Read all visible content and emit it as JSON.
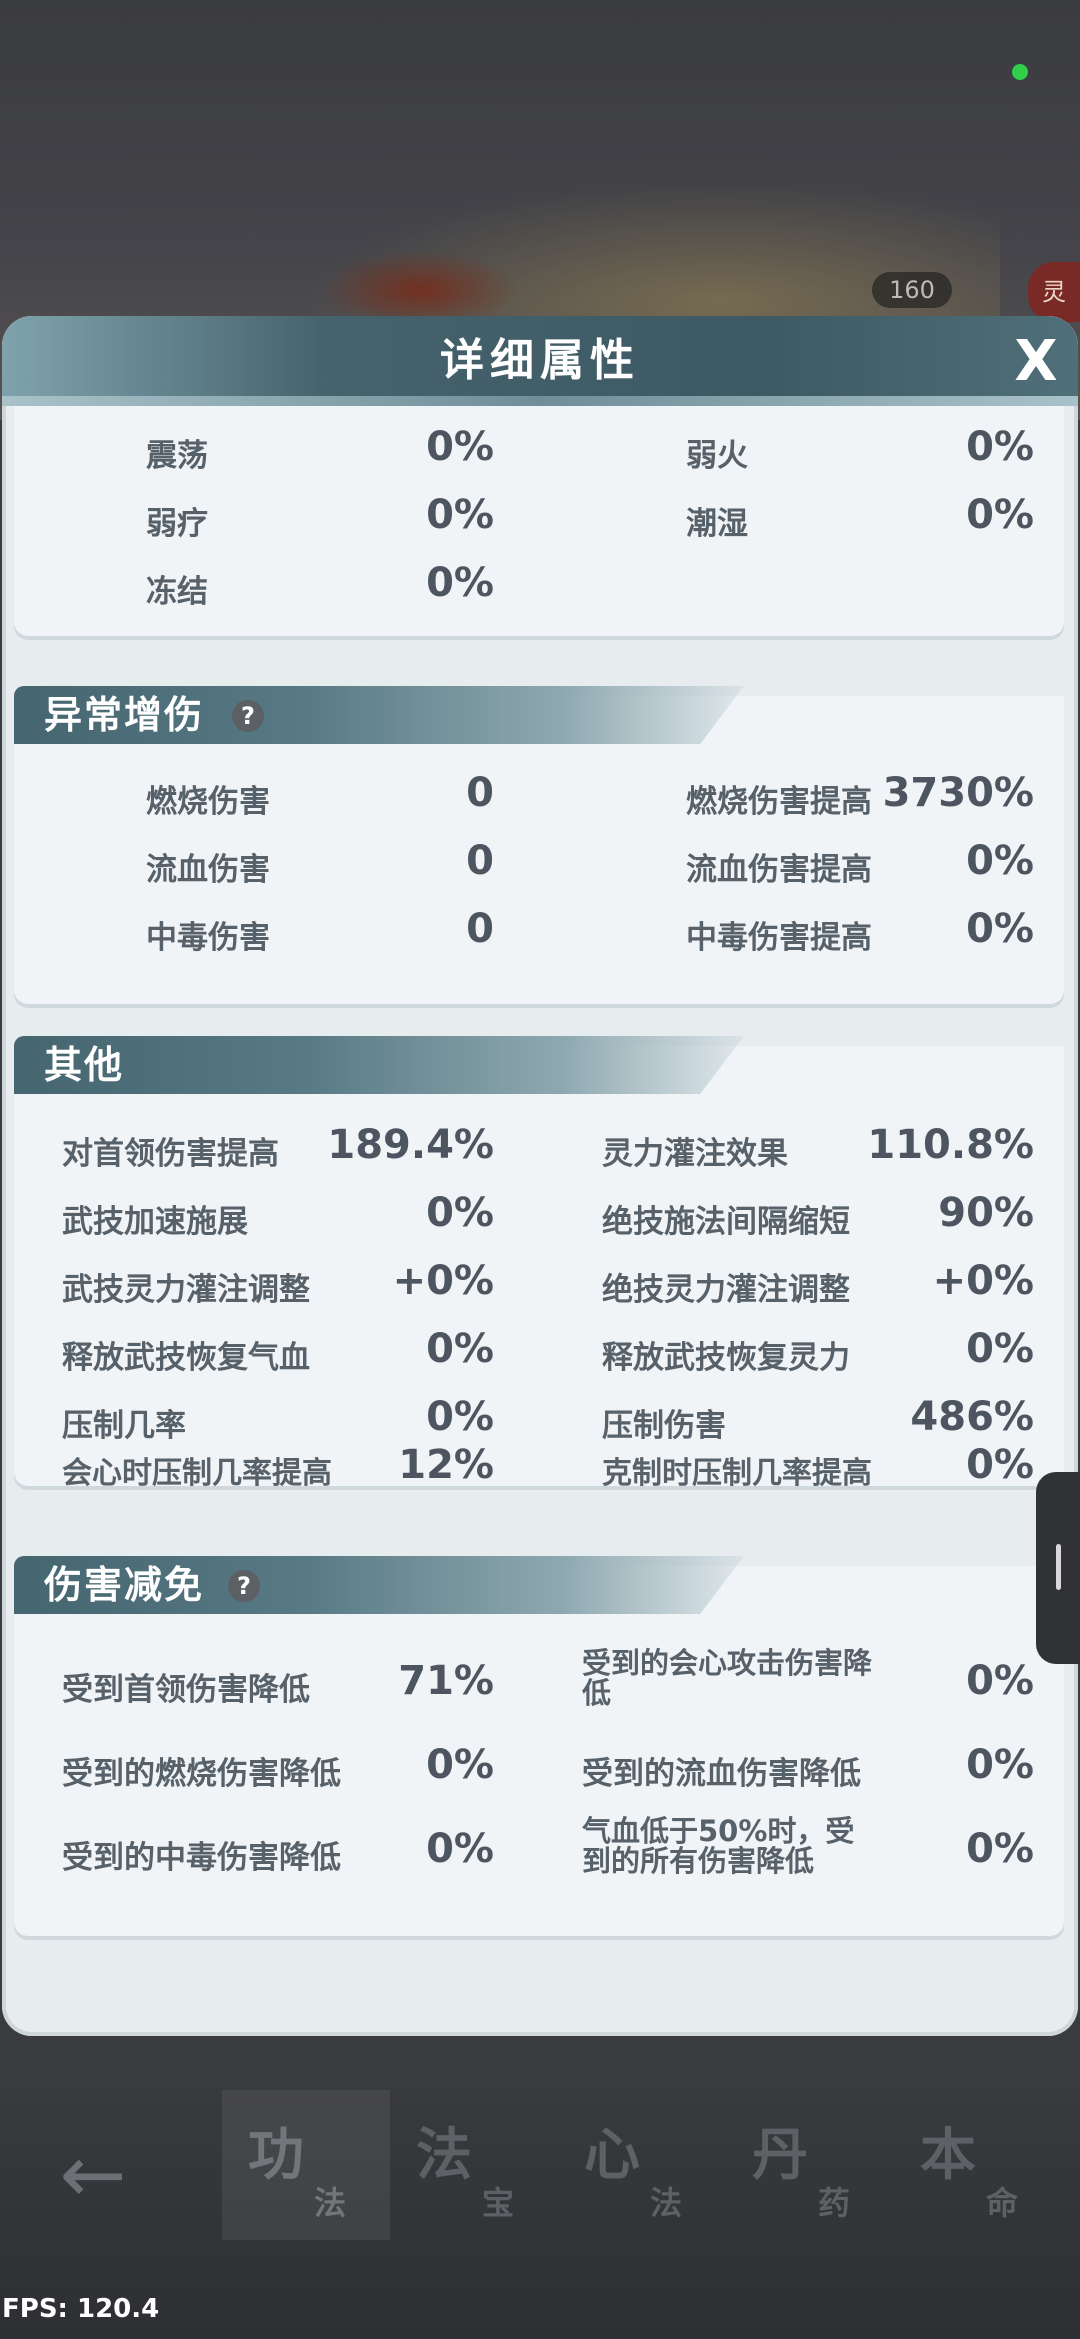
{
  "background": {
    "level_badge": "160",
    "side_badge": "灵"
  },
  "modal": {
    "title": "详细属性",
    "close_label": "X"
  },
  "control_section": {
    "rows": [
      {
        "label": "震荡",
        "value": "0%"
      },
      {
        "label": "弱火",
        "value": "0%"
      },
      {
        "label": "弱疗",
        "value": "0%"
      },
      {
        "label": "潮湿",
        "value": "0%"
      },
      {
        "label": "冻结",
        "value": "0%"
      }
    ]
  },
  "abnormal_damage": {
    "title": "异常增伤",
    "help": "?",
    "rows": [
      {
        "label": "燃烧伤害",
        "value": "0"
      },
      {
        "label": "燃烧伤害提高",
        "value": "3730%"
      },
      {
        "label": "流血伤害",
        "value": "0"
      },
      {
        "label": "流血伤害提高",
        "value": "0%"
      },
      {
        "label": "中毒伤害",
        "value": "0"
      },
      {
        "label": "中毒伤害提高",
        "value": "0%"
      }
    ]
  },
  "other": {
    "title": "其他",
    "rows": [
      {
        "label": "对首领伤害提高",
        "value": "189.4%"
      },
      {
        "label": "灵力灌注效果",
        "value": "110.8%"
      },
      {
        "label": "武技加速施展",
        "value": "0%"
      },
      {
        "label": "绝技施法间隔缩短",
        "value": "90%"
      },
      {
        "label": "武技灵力灌注调整",
        "value": "+0%"
      },
      {
        "label": "绝技灵力灌注调整",
        "value": "+0%"
      },
      {
        "label": "释放武技恢复气血",
        "value": "0%"
      },
      {
        "label": "释放武技恢复灵力",
        "value": "0%"
      },
      {
        "label": "压制几率",
        "value": "0%"
      },
      {
        "label": "压制伤害",
        "value": "486%"
      },
      {
        "label": "会心时压制几率提高",
        "value": "12%"
      },
      {
        "label": "克制时压制几率提高",
        "value": "0%"
      }
    ]
  },
  "damage_reduction": {
    "title": "伤害减免",
    "help": "?",
    "rows": [
      {
        "label": "受到首领伤害降低",
        "value": "71%"
      },
      {
        "label": "受到的会心攻击伤害降低",
        "value": "0%"
      },
      {
        "label": "受到的燃烧伤害降低",
        "value": "0%"
      },
      {
        "label": "受到的流血伤害降低",
        "value": "0%"
      },
      {
        "label": "受到的中毒伤害降低",
        "value": "0%"
      },
      {
        "label": "气血低于50%时，受到的所有伤害降低",
        "value": "0%"
      }
    ]
  },
  "bottom_nav": {
    "tabs": [
      {
        "big": "功",
        "small": "法"
      },
      {
        "big": "法",
        "small": "宝"
      },
      {
        "big": "心",
        "small": "法"
      },
      {
        "big": "丹",
        "small": "药"
      },
      {
        "big": "本",
        "small": "命"
      }
    ]
  },
  "fps": "FPS: 120.4"
}
